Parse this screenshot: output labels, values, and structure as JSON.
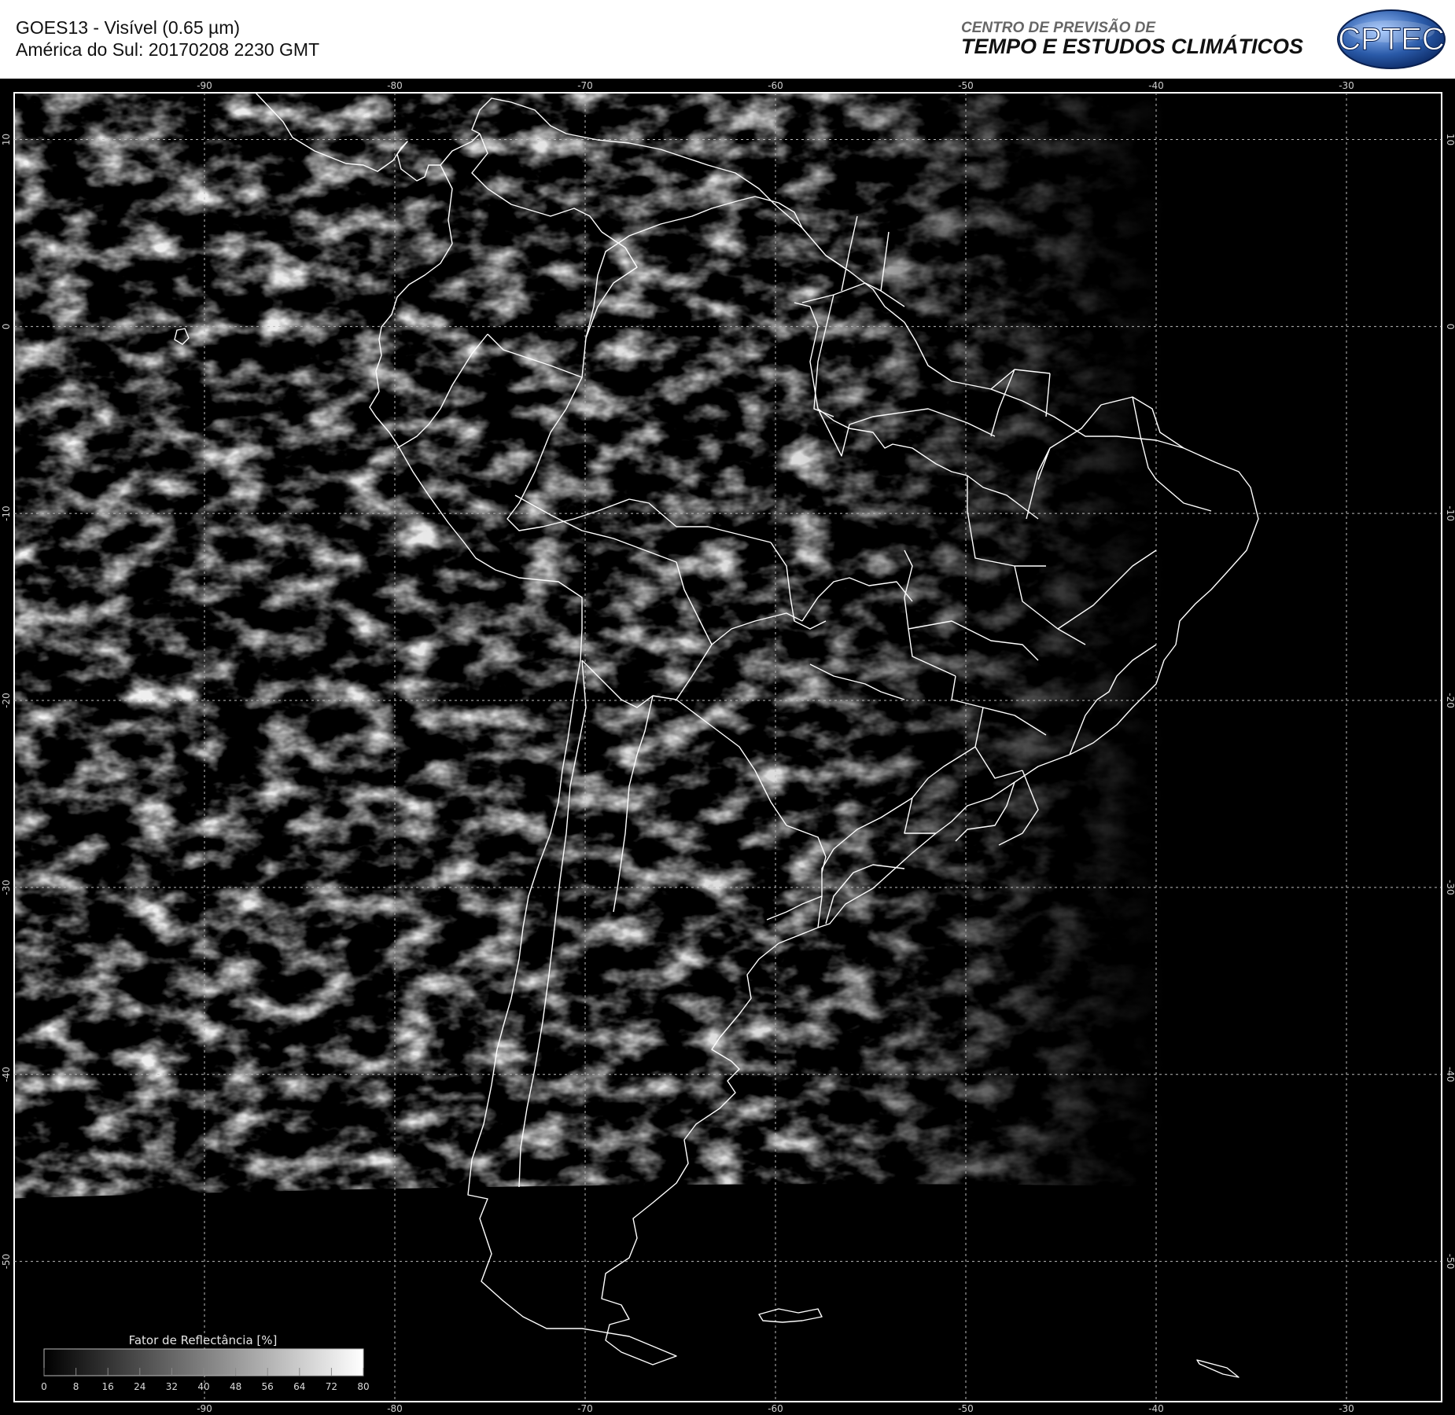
{
  "header": {
    "title_line1": "GOES13 - Visível (0.65 µm)",
    "title_line2": "América do Sul: 20170208 2230 GMT",
    "org_line1": "CENTRO DE PREVISÃO DE",
    "org_line2": "TEMPO E ESTUDOS CLIMÁTICOS",
    "logo_text": "CPTEC"
  },
  "map": {
    "lon_ticks": [
      -90,
      -80,
      -70,
      -60,
      -50,
      -40,
      -30
    ],
    "lat_ticks": [
      10,
      0,
      -10,
      -20,
      -30,
      -40,
      -50
    ],
    "lon_range": [
      -100,
      -25
    ],
    "lat_range": [
      12.5,
      -57.5
    ]
  },
  "colorbar": {
    "title": "Fator de Reflectância [%]",
    "ticks": [
      0,
      8,
      16,
      24,
      32,
      40,
      48,
      56,
      64,
      72,
      80
    ],
    "range": [
      0,
      80
    ]
  },
  "colors": {
    "background": "#000000",
    "coastline": "#ffffff",
    "grid": "#bbbbbb",
    "logo_blue": "#2a5aa8"
  }
}
